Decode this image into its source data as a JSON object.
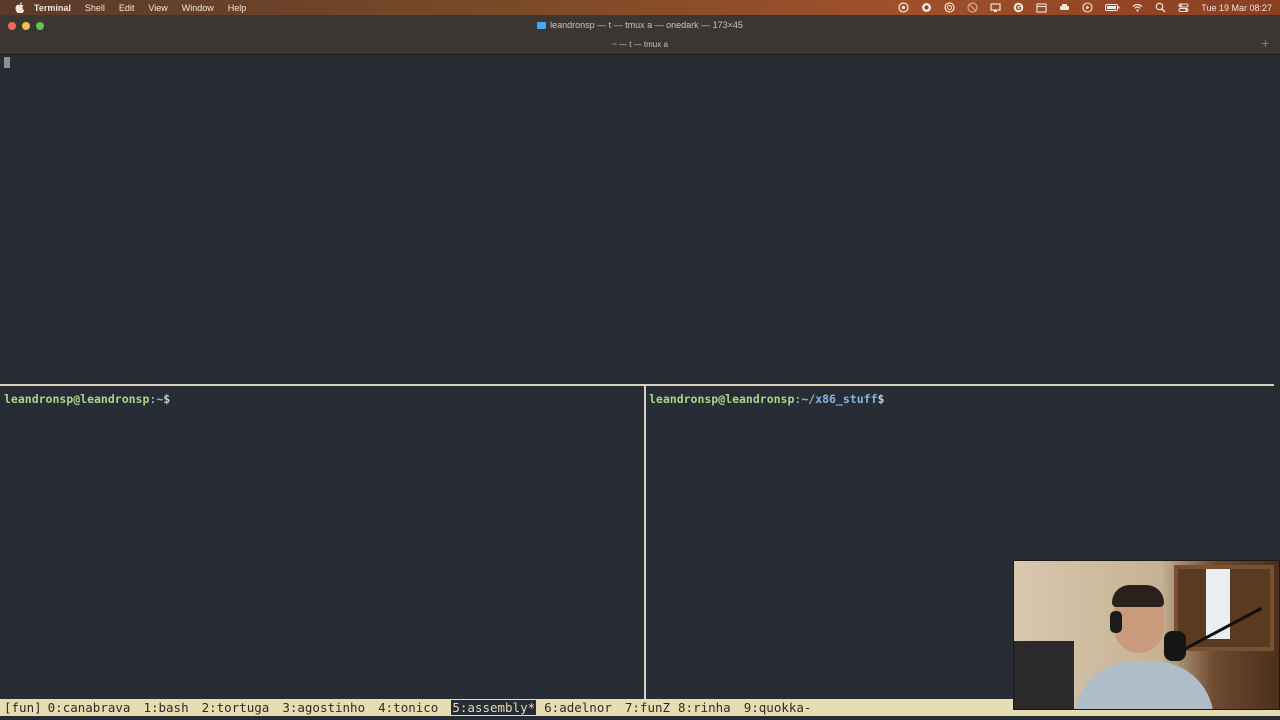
{
  "menubar": {
    "app": "Terminal",
    "items": [
      "Shell",
      "Edit",
      "View",
      "Window",
      "Help"
    ],
    "clock": "Tue 19 Mar  08:27"
  },
  "window": {
    "title": "leandronsp — t — tmux a — onedark — 173×45",
    "tab_title": "~ — t — tmux a",
    "plus": "+"
  },
  "panes": {
    "left": {
      "user": "leandronsp@leandronsp",
      "sep": ":",
      "path": "~",
      "dollar": "$"
    },
    "right": {
      "user": "leandronsp@leandronsp",
      "sep": ":",
      "path": "~/x86_stuff",
      "dollar": "$"
    }
  },
  "tmux": {
    "session": "[fun]",
    "windows": [
      {
        "label": "0:canabrava"
      },
      {
        "label": "1:bash"
      },
      {
        "label": "2:tortuga"
      },
      {
        "label": "3:agostinho"
      },
      {
        "label": "4:tonico"
      },
      {
        "label": "5:assembly*"
      },
      {
        "label": "6:adelnor"
      },
      {
        "label": "7:funZ"
      },
      {
        "label": "8:rinha"
      },
      {
        "label": "9:quokka-"
      }
    ]
  },
  "colors": {
    "terminal_bg": "#282c34",
    "status_bg": "#e8ddb2",
    "prompt_user": "#a8d58c",
    "prompt_path": "#7fb8e6"
  }
}
